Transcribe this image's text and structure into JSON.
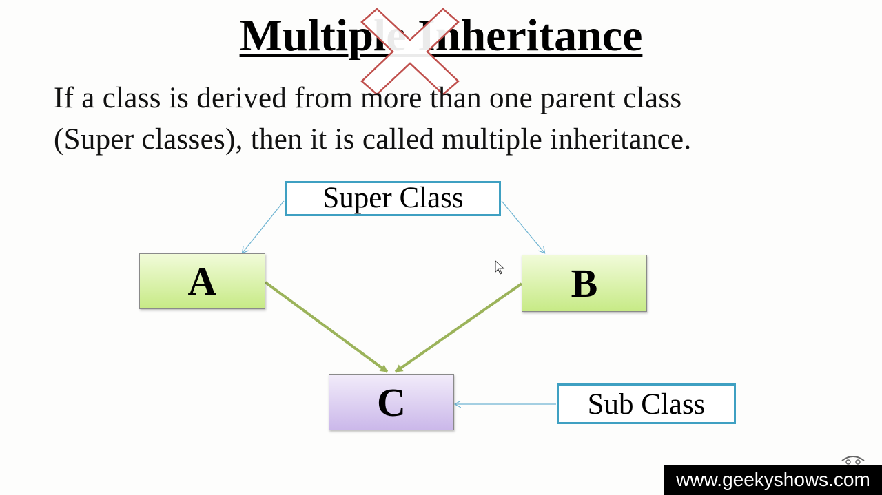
{
  "slide": {
    "title": "Multiple Inheritance",
    "definition_line1": "If a class is derived from more than one parent class",
    "definition_line2": "(Super classes), then it is called multiple inheritance."
  },
  "diagram": {
    "super_label": "Super Class",
    "sub_label": "Sub Class",
    "node_a": "A",
    "node_b": "B",
    "node_c": "C"
  },
  "colors": {
    "callout_border": "#3fa0c2",
    "parent_fill": "#c7ea86",
    "child_fill": "#cbb8ea",
    "inherit_arrow": "#9bb35a",
    "cross_mark": "#c0504d"
  },
  "watermark": "www.geekyshows.com"
}
